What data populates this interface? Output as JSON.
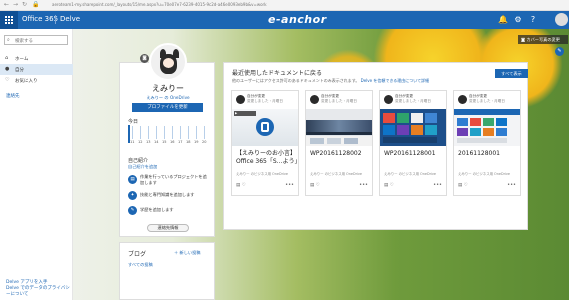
{
  "browser": {
    "url": "aeroteam1-my.sharepoint.com/_layouts/15/me.aspx?u=70e07e7-6239-4015-9c2d-a46e0093eb9b&v=work"
  },
  "suitebar": {
    "app_name": "Office 365",
    "service_name": "Delve",
    "brand": "e-anchor",
    "icons": [
      "bell-icon",
      "gear-icon",
      "help-icon"
    ]
  },
  "sidebar": {
    "search_placeholder": "検索する",
    "items": [
      {
        "label": "ホーム",
        "icon": "home-icon",
        "active": false
      },
      {
        "label": "自分",
        "icon": "person-icon",
        "active": true
      },
      {
        "label": "お気に入り",
        "icon": "heart-icon",
        "active": false
      }
    ],
    "link": "連絡先",
    "footer_1": "Delve アプリを入手",
    "footer_2": "Delve でのデータのプライバシーについて"
  },
  "cover": {
    "change_photo": "カバー写真の変更"
  },
  "profile": {
    "name": "えみりー",
    "onedrive": "えみりー の OneDrive",
    "update_button": "プロファイルを更新",
    "today_label": "今日",
    "timeline_days": [
      "11",
      "12",
      "13",
      "14",
      "15",
      "16",
      "17",
      "18",
      "19",
      "20"
    ],
    "about_heading": "自己紹介",
    "about_link": "自己紹介を追加",
    "actions": [
      "作業を行っているプロジェクトを追加します",
      "技能と専門知識を追加します",
      "学歴を追加します"
    ],
    "org_button": "連絡先情報"
  },
  "blog": {
    "title": "ブログ",
    "new_post": "新しい投稿",
    "all_posts": "すべての投稿"
  },
  "documents": {
    "title": "最近使用したドキュメントに戻る",
    "subtitle_text": "他のユーザーにはアクセス許可のあるドキュメントのみ表示されます。",
    "subtitle_link": "Delve を信頼できる理由について詳細",
    "show_all": "すべて表示",
    "cards": [
      {
        "owner": "自分が変更",
        "when": "変更しました・月曜日",
        "title": "【えみりーのお小言】Office 365「S…よう」",
        "meta": "えみりー のビジネス用 OneDrive",
        "thumb": "video"
      },
      {
        "owner": "自分が変更",
        "when": "変更しました・月曜日",
        "title": "WP20161128002",
        "meta": "えみりー のビジネス用 OneDrive",
        "thumb": "panorama"
      },
      {
        "owner": "自分が変更",
        "when": "変更しました・月曜日",
        "title": "WP20161128001",
        "meta": "えみりー のビジネス用 OneDrive",
        "thumb": "tiles"
      },
      {
        "owner": "自分が変更",
        "when": "変更しました・月曜日",
        "title": "20161128001",
        "meta": "えみりー のビジネス用 OneDrive",
        "thumb": "tiles2"
      }
    ]
  },
  "colors": {
    "suitebar": "#1c66b3",
    "accent": "#1c66b3"
  }
}
